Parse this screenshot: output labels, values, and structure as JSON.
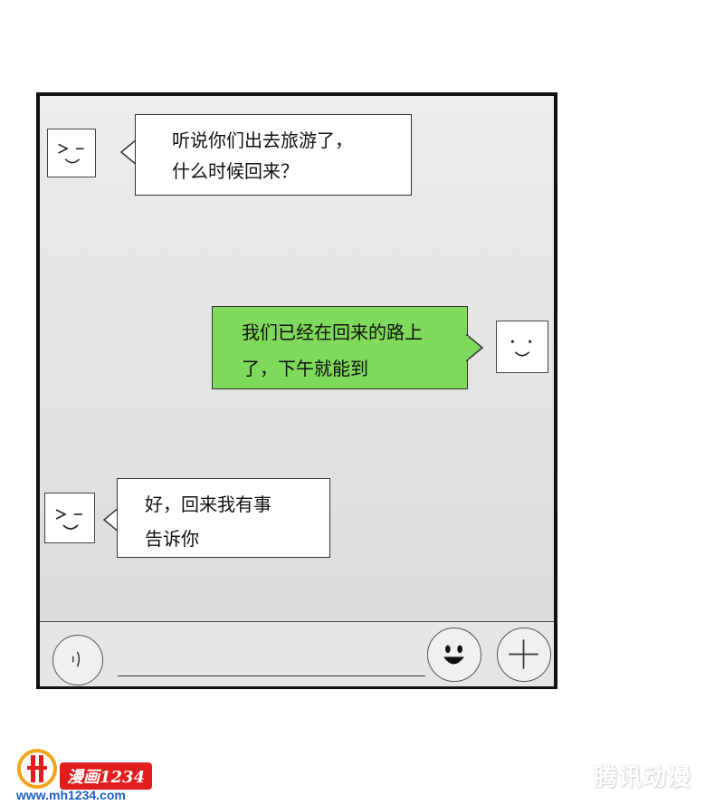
{
  "messages": [
    {
      "side": "left",
      "lines": [
        "听说你们出去旅游了，",
        "什么时候回来？"
      ],
      "avatar_icon": "squint-smile-icon"
    },
    {
      "side": "right",
      "lines": [
        "我们已经在回来的路上",
        "了，下午就能到"
      ],
      "avatar_icon": "smile-icon"
    },
    {
      "side": "left",
      "lines": [
        "好，回来我有事",
        "告诉你"
      ],
      "avatar_icon": "squint-smile-icon"
    }
  ],
  "toolbar": {
    "voice_icon": "voice-icon",
    "emoji_icon": "emoji-icon",
    "add_icon": "plus-icon",
    "input_value": ""
  },
  "branding": {
    "logo_text": "漫画1234",
    "url": "www.mh1234.com",
    "watermark": "腾讯动漫"
  },
  "colors": {
    "sent_bubble": "#7fd95a",
    "received_bubble": "#ffffff",
    "chat_background": "#e4e4e6"
  }
}
